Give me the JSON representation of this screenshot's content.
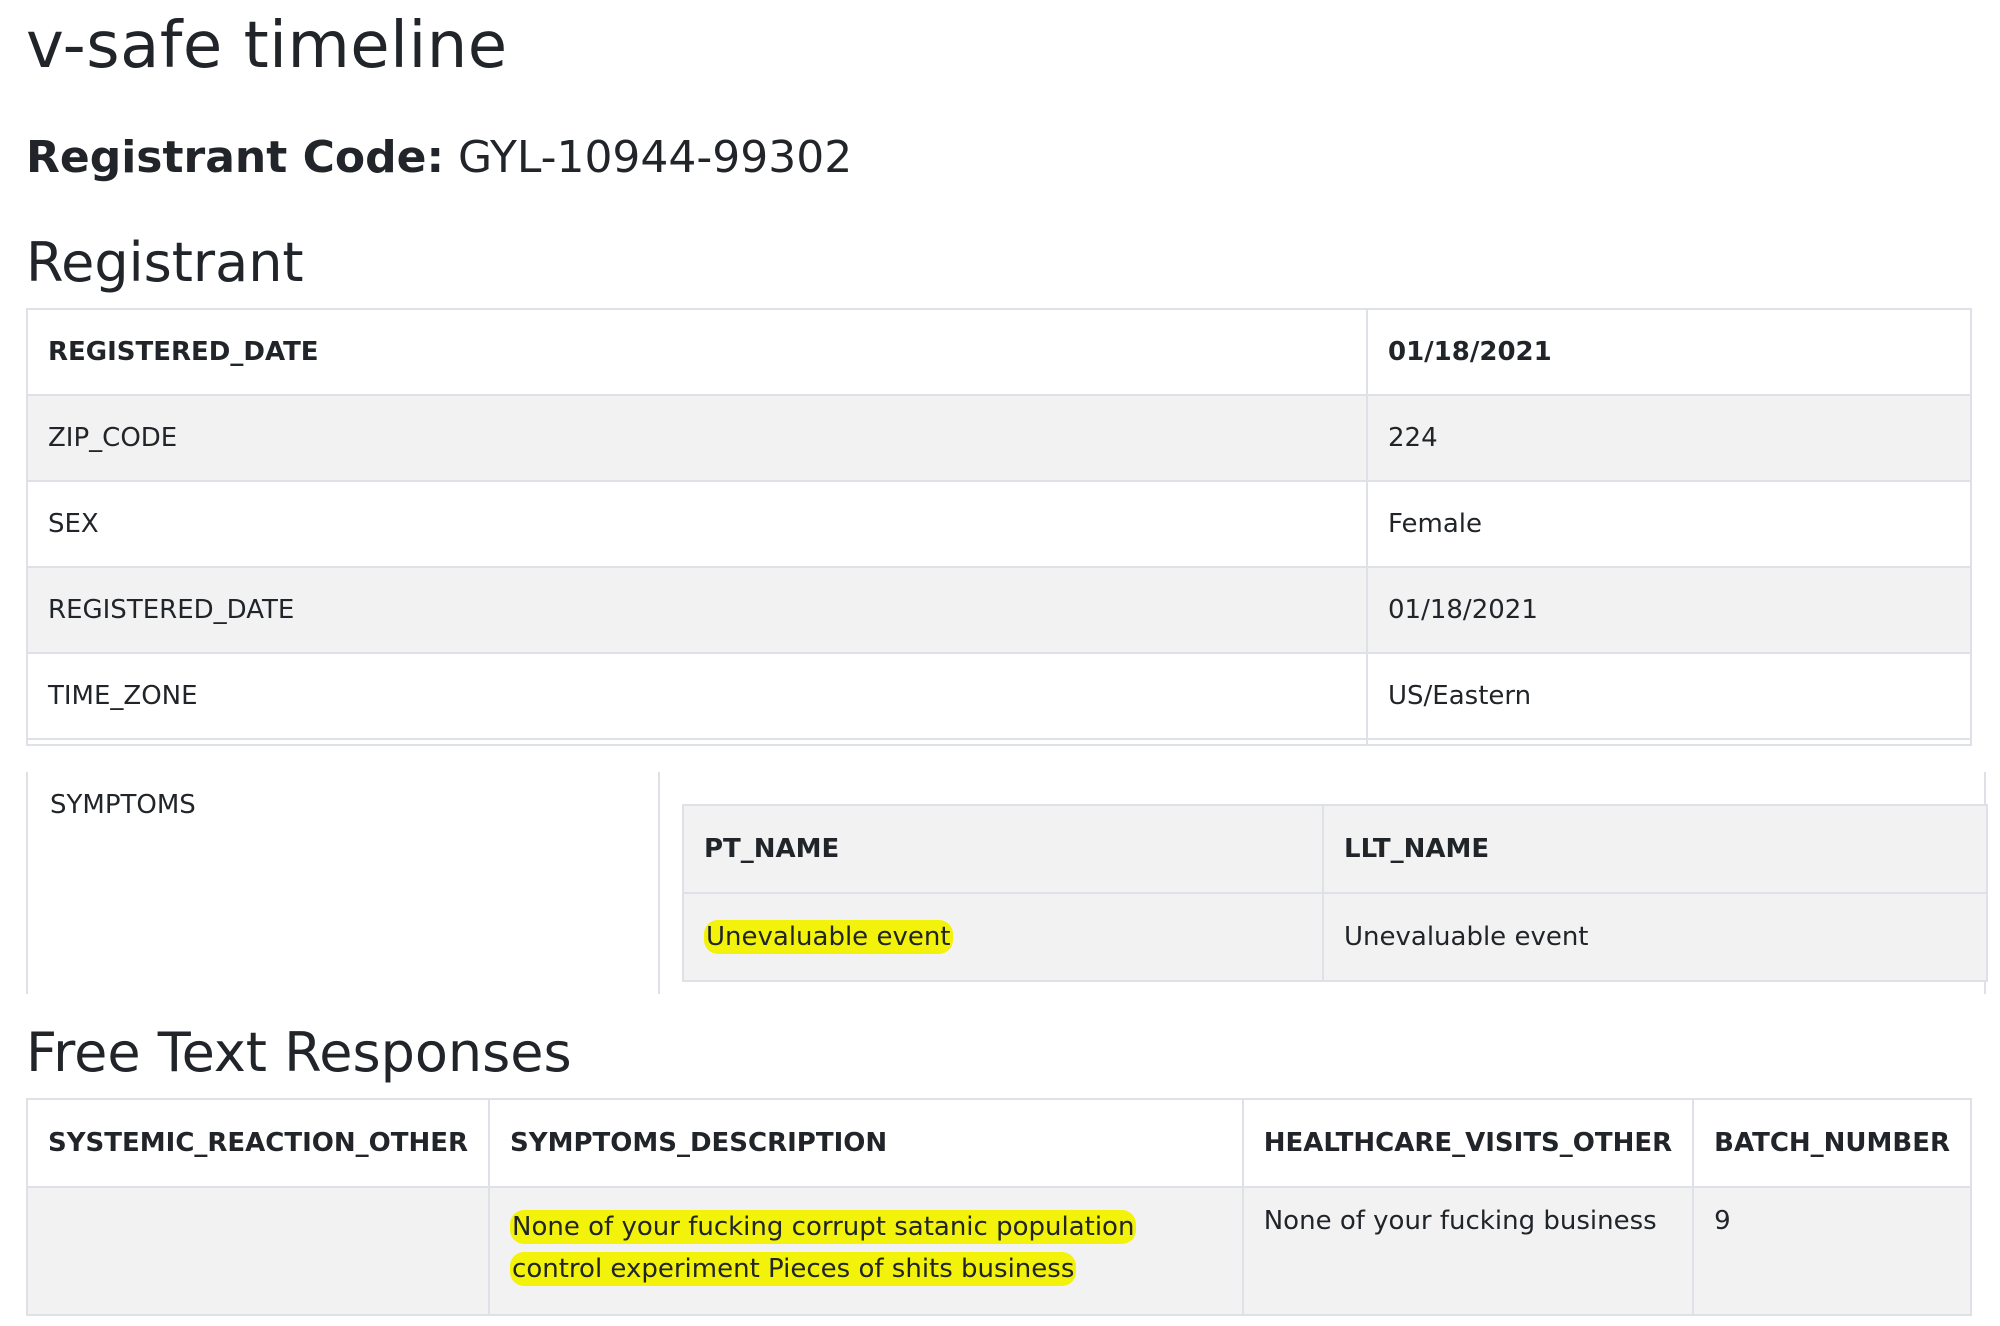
{
  "title": "v-safe timeline",
  "registrant_code": {
    "label": "Registrant Code:",
    "value": "GYL-10944-99302"
  },
  "registrant": {
    "heading": "Registrant",
    "header": [
      "REGISTERED_DATE",
      "01/18/2021"
    ],
    "rows": [
      [
        "ZIP_CODE",
        "224"
      ],
      [
        "SEX",
        "Female"
      ],
      [
        "REGISTERED_DATE",
        "01/18/2021"
      ],
      [
        "TIME_ZONE",
        "US/Eastern"
      ]
    ]
  },
  "symptoms": {
    "label": "SYMPTOMS",
    "columns": [
      "PT_NAME",
      "LLT_NAME"
    ],
    "rows": [
      [
        "Unevaluable event",
        "Unevaluable event"
      ]
    ],
    "highlight_color": "#f2f20a"
  },
  "free_text": {
    "heading": "Free Text Responses",
    "columns": [
      "SYSTEMIC_REACTION_OTHER",
      "SYMPTOMS_DESCRIPTION",
      "HEALTHCARE_VISITS_OTHER",
      "BATCH_NUMBER"
    ],
    "rows": [
      [
        "",
        "None of your fucking corrupt satanic population control experiment Pieces of shits business",
        "None of your fucking business",
        "9"
      ]
    ]
  },
  "colors": {
    "border": "#dee2e6",
    "stripe": "#f2f2f2",
    "text": "#212529"
  }
}
